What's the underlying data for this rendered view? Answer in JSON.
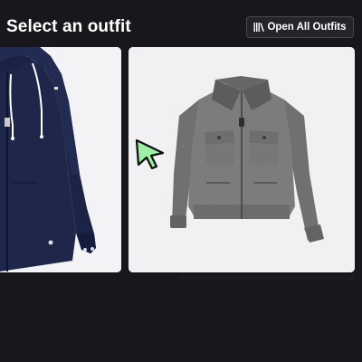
{
  "header": {
    "title": "Select an outfit",
    "open_all_label": "Open All Outfits",
    "open_all_icon": "library-icon"
  },
  "outfits": [
    {
      "name": "Navy hooded jacket",
      "icon": "navy-hooded-jacket-image",
      "colors": {
        "body": "#1c2546",
        "trim": "#ffffff"
      }
    },
    {
      "name": "Grey wool bomber jacket",
      "icon": "grey-bomber-jacket-image",
      "colors": {
        "body": "#7b7b7e",
        "collar": "#5f5f62"
      }
    }
  ],
  "cursor": {
    "icon": "pointer-cursor-icon",
    "color": "#9ef0a6"
  },
  "colors": {
    "background": "#18171b",
    "button_bg": "#25242a",
    "button_border": "#4a4950",
    "card_bg": "#f2f2f4"
  }
}
